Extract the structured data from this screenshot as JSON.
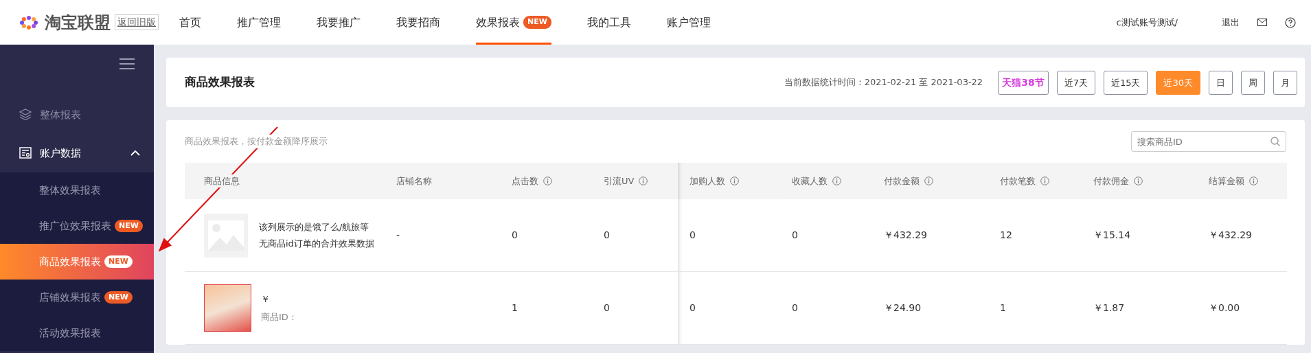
{
  "topbar": {
    "logo_text": "淘宝联盟",
    "old_version": "返回旧版",
    "nav": [
      {
        "label": "首页",
        "selected": false
      },
      {
        "label": "推广管理",
        "selected": false
      },
      {
        "label": "我要推广",
        "selected": false
      },
      {
        "label": "我要招商",
        "selected": false
      },
      {
        "label": "效果报表",
        "selected": true,
        "badge": "NEW"
      },
      {
        "label": "我的工具",
        "selected": false
      },
      {
        "label": "账户管理",
        "selected": false
      }
    ],
    "user": "c测试账号测试/",
    "logout": "退出"
  },
  "sidebar": {
    "groups": [
      {
        "label": "整体报表",
        "kind": "layers",
        "selected": false
      },
      {
        "label": "账户数据",
        "kind": "report",
        "selected": true,
        "expanded": true,
        "children": [
          {
            "label": "整体效果报表",
            "selected": false
          },
          {
            "label": "推广位效果报表",
            "selected": false,
            "badge": "NEW"
          },
          {
            "label": "商品效果报表",
            "selected": true,
            "badge": "NEW"
          },
          {
            "label": "店铺效果报表",
            "selected": false,
            "badge": "NEW"
          },
          {
            "label": "活动效果报表",
            "selected": false
          }
        ]
      }
    ]
  },
  "header": {
    "title": "商品效果报表",
    "date_range": "当前数据统计时间：2021-02-21 至 2021-03-22",
    "promo": "天猫38节",
    "ranges": [
      {
        "label": "近7天",
        "selected": false
      },
      {
        "label": "近15天",
        "selected": false
      },
      {
        "label": "近30天",
        "selected": true
      },
      {
        "label": "日",
        "selected": false
      },
      {
        "label": "周",
        "selected": false
      },
      {
        "label": "月",
        "selected": false
      }
    ]
  },
  "report": {
    "caption": "商品效果报表，按付款金额降序展示",
    "search": {
      "placeholder": "搜索商品ID"
    },
    "columns": [
      {
        "label": "商品信息",
        "info": false
      },
      {
        "label": "店铺名称",
        "info": false
      },
      {
        "label": "点击数",
        "info": true
      },
      {
        "label": "引流UV",
        "info": true
      },
      {
        "label": "加购人数",
        "info": true
      },
      {
        "label": "收藏人数",
        "info": true
      },
      {
        "label": "付款金额",
        "info": true
      },
      {
        "label": "付款笔数",
        "info": true
      },
      {
        "label": "付款佣金",
        "info": true
      },
      {
        "label": "结算金额",
        "info": true
      }
    ],
    "rows": [
      {
        "cells": [
          {
            "kind": "default-image",
            "lines": [
              "该列展示的是饿了么/航旅等无商品id订单的合并效果数据"
            ]
          },
          "-",
          "0",
          "0",
          "0",
          "0",
          "￥432.29",
          "12",
          "￥15.14",
          "￥432.29"
        ]
      },
      {
        "cells": [
          {
            "kind": "photo",
            "lines": [
              "￥",
              "商品ID："
            ]
          },
          "",
          "1",
          "0",
          "0",
          "0",
          "￥24.90",
          "1",
          "￥1.87",
          "￥0.00"
        ]
      }
    ]
  }
}
